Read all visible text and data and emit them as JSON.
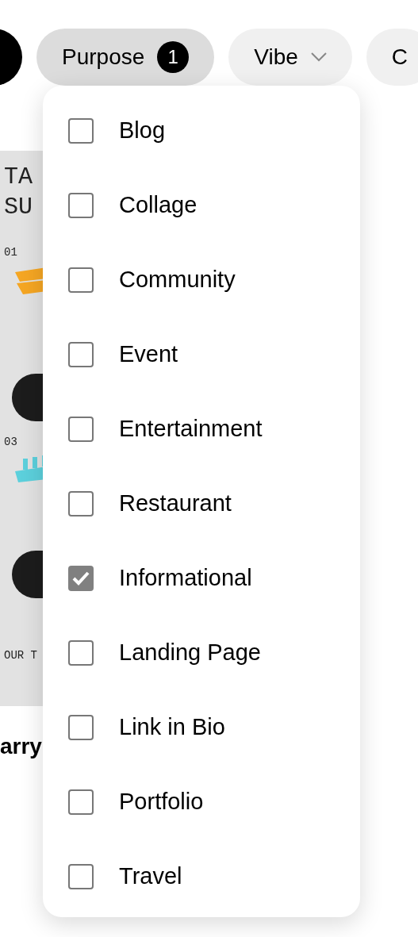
{
  "filters": [
    {
      "kind": "dark"
    },
    {
      "label": "Purpose",
      "kind": "count",
      "badge": "1",
      "selected": true
    },
    {
      "label": "Vibe",
      "kind": "menu",
      "selected": false
    },
    {
      "label": "C",
      "kind": "menu",
      "selected": false
    }
  ],
  "background_card": {
    "heading_lines": [
      "TA",
      "SU"
    ],
    "numbers": [
      "01",
      "03"
    ],
    "footer": "OUR T"
  },
  "caption": "arry",
  "purpose_menu": [
    {
      "label": "Blog",
      "checked": false
    },
    {
      "label": "Collage",
      "checked": false
    },
    {
      "label": "Community",
      "checked": false
    },
    {
      "label": "Event",
      "checked": false
    },
    {
      "label": "Entertainment",
      "checked": false
    },
    {
      "label": "Restaurant",
      "checked": false
    },
    {
      "label": "Informational",
      "checked": true
    },
    {
      "label": "Landing Page",
      "checked": false
    },
    {
      "label": "Link in Bio",
      "checked": false
    },
    {
      "label": "Portfolio",
      "checked": false
    },
    {
      "label": "Travel",
      "checked": false
    }
  ]
}
